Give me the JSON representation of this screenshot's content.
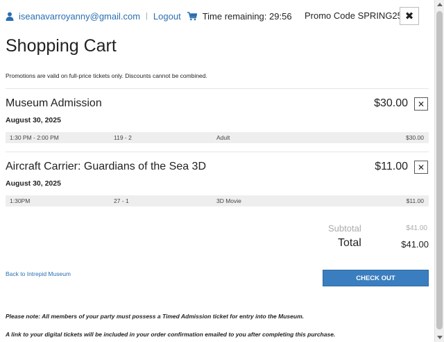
{
  "topbar": {
    "user_icon": "user-icon",
    "email": "iseanavarroyanny@gmail.com",
    "separator": "|",
    "logout_label": "Logout",
    "cart_icon": "shopping-cart-icon",
    "time_remaining": "Time remaining: 29:56",
    "promo_code": "Promo Code SPRING25",
    "close_label": "✖"
  },
  "page": {
    "title": "Shopping Cart",
    "promo_note": "Promotions are valid on full-price tickets only.  Discounts cannot be combined."
  },
  "items": [
    {
      "name": "Museum Admission",
      "price": "$30.00",
      "remove_label": "✕",
      "date": "August 30, 2025",
      "details": {
        "time": "1:30 PM - 2:00 PM",
        "code": "119 - 2",
        "type": "Adult",
        "amount": "$30.00"
      }
    },
    {
      "name": "Aircraft Carrier: Guardians of the Sea 3D",
      "price": "$11.00",
      "remove_label": "✕",
      "date": "August 30, 2025",
      "details": {
        "time": "1:30PM",
        "code": "27 - 1",
        "type": "3D Movie",
        "amount": "$11.00"
      }
    }
  ],
  "summary": {
    "subtotal_label": "Subtotal",
    "subtotal_value": "$41.00",
    "total_label": "Total",
    "total_value": "$41.00"
  },
  "actions": {
    "back_link": "Back to Intrepid Museum",
    "checkout_label": "CHECK OUT"
  },
  "notes": [
    "Please note: All members of your party must possess a Timed Admission ticket for entry into the Museum.",
    "A link to your digital tickets will be included in your order confirmation emailed to you after completing this purchase."
  ],
  "colors": {
    "link": "#2a6fb0",
    "checkout_button": "#3a7ebf",
    "detail_row_bg": "#eeeeee"
  }
}
